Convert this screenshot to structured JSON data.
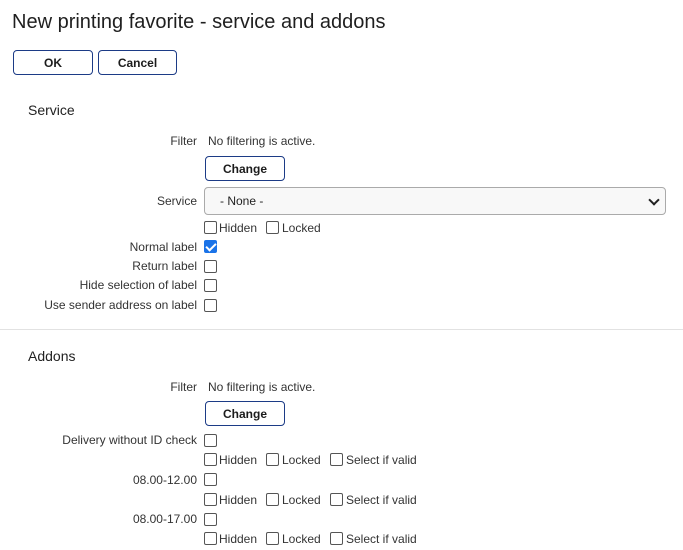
{
  "page": {
    "title": "New printing favorite - service and addons"
  },
  "toolbar": {
    "ok_label": "OK",
    "cancel_label": "Cancel"
  },
  "service_section": {
    "title": "Service",
    "filter_label": "Filter",
    "filter_value": "No filtering is active.",
    "change_label": "Change",
    "service_label": "Service",
    "service_selected": "- None -",
    "hidden_label": "Hidden",
    "locked_label": "Locked",
    "hidden_checked": false,
    "locked_checked": false,
    "options": [
      {
        "label": "Normal label",
        "checked": true
      },
      {
        "label": "Return label",
        "checked": false
      },
      {
        "label": "Hide selection of label",
        "checked": false
      },
      {
        "label": "Use sender address on label",
        "checked": false
      }
    ]
  },
  "addons_section": {
    "title": "Addons",
    "filter_label": "Filter",
    "filter_value": "No filtering is active.",
    "change_label": "Change",
    "hidden_label": "Hidden",
    "locked_label": "Locked",
    "select_if_valid_label": "Select if valid",
    "addons": [
      {
        "label": "Delivery without ID check",
        "checked": false,
        "hidden": false,
        "locked": false,
        "select_if_valid": false
      },
      {
        "label": "08.00-12.00",
        "checked": false,
        "hidden": false,
        "locked": false,
        "select_if_valid": false
      },
      {
        "label": "08.00-17.00",
        "checked": false,
        "hidden": false,
        "locked": false,
        "select_if_valid": false
      }
    ]
  },
  "colors": {
    "accent": "#1c3b86",
    "checkbox_checked": "#1a73e8"
  }
}
